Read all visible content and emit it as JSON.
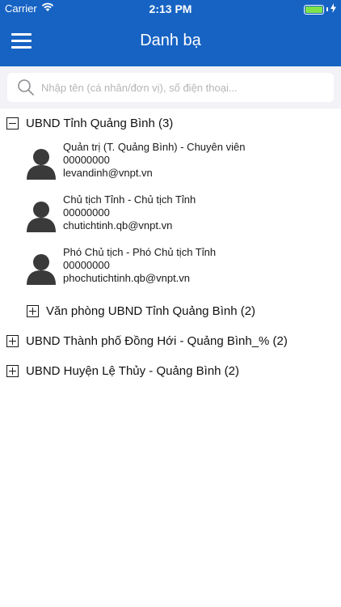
{
  "status_bar": {
    "carrier": "Carrier",
    "time": "2:13 PM",
    "icons": [
      "wifi-icon",
      "battery-icon",
      "charging-icon"
    ]
  },
  "nav": {
    "title": "Danh bạ",
    "menu_icon": "hamburger-menu-icon"
  },
  "search": {
    "placeholder": "Nhập tên (cá nhân/đơn vị), số điện thoại...",
    "value": ""
  },
  "colors": {
    "header": "#1763c4",
    "search_background": "#f2f2f7",
    "avatar": "#3a3a3a"
  },
  "tree": {
    "group_1": {
      "label": "UBND Tỉnh Quảng Bình (3)",
      "expanded": true,
      "contacts": [
        {
          "title": "Quản trị (T. Quảng Bình) - Chuyên viên",
          "phone": "00000000",
          "email": "levandinh@vnpt.vn"
        },
        {
          "title": "Chủ tịch Tỉnh - Chủ tịch Tỉnh",
          "phone": "00000000",
          "email": "chutichtinh.qb@vnpt.vn"
        },
        {
          "title": "Phó Chủ tịch - Phó Chủ tịch Tỉnh",
          "phone": "00000000",
          "email": "phochutichtinh.qb@vnpt.vn"
        }
      ],
      "subgroup": {
        "label": "Văn phòng UBND Tỉnh Quảng Bình (2)",
        "expanded": false
      }
    },
    "group_2": {
      "label": "UBND Thành phố Đồng Hới - Quảng Bình_% (2)",
      "expanded": false
    },
    "group_3": {
      "label": "UBND Huyện Lệ Thủy - Quảng Bình (2)",
      "expanded": false
    }
  }
}
